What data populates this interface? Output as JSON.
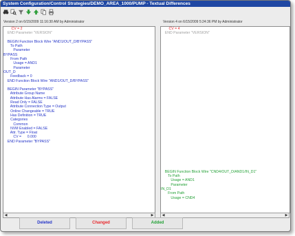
{
  "window": {
    "title": "System Configuration/Control Strategies/DEMO_AREA_1000/PUMP - Textual Differences"
  },
  "toolbar": {
    "icons": [
      "binoculars-icon",
      "find-next-icon",
      "filter-icon",
      "next-difference-icon",
      "previous-difference-icon",
      "copy-icon",
      "print-icon"
    ]
  },
  "left": {
    "header": "Version 2 on 6/15/2009 11:16:30 AM by Administrator",
    "lines": [
      {
        "t": "        CV = 2",
        "k": "c"
      },
      {
        "t": "    END Parameter \"VERSION\"",
        "k": "u"
      },
      {
        "t": "",
        "k": "u"
      },
      {
        "t": "    BEGIN Function Block Wire \"AND1/OUT_D/BYPASS\"",
        "k": "d"
      },
      {
        "t": "       To Path",
        "k": "d"
      },
      {
        "t": "          Parameter",
        "k": "d"
      },
      {
        "t": "BYPASS",
        "k": "d"
      },
      {
        "t": "       From Path",
        "k": "d"
      },
      {
        "t": "          Usage = AND1",
        "k": "d"
      },
      {
        "t": "          Parameter",
        "k": "d"
      },
      {
        "t": "OUT_D",
        "k": "d"
      },
      {
        "t": "       Feedback = 0",
        "k": "d"
      },
      {
        "t": "    END Function Block Wire \"AND1/OUT_D/BYPASS\"",
        "k": "d"
      },
      {
        "t": "",
        "k": "d"
      },
      {
        "t": "    BEGIN Parameter \"BYPASS\"",
        "k": "d"
      },
      {
        "t": "       Attribute Group Name",
        "k": "d"
      },
      {
        "t": "       Attribute Has Alarms = FALSE",
        "k": "d"
      },
      {
        "t": "       Read Only = FALSE",
        "k": "d"
      },
      {
        "t": "       Attribute Connection Type = Output",
        "k": "d"
      },
      {
        "t": "       Online Changeable = TRUE",
        "k": "d"
      },
      {
        "t": "       Has Definition = TRUE",
        "k": "d"
      },
      {
        "t": "       Categories",
        "k": "d"
      },
      {
        "t": "          Common",
        "k": "d"
      },
      {
        "t": "       NVM Enabled = FALSE",
        "k": "d"
      },
      {
        "t": "       Attr. Type = Float",
        "k": "d"
      },
      {
        "t": "          CV =      0.000",
        "k": "d"
      },
      {
        "t": "    END Parameter \"BYPASS\"",
        "k": "d"
      }
    ]
  },
  "right": {
    "header": "Version 4 on 6/15/2009 5:24:36 PM by Administrator",
    "lines": [
      {
        "t": "        CV = 4",
        "k": "c"
      },
      {
        "t": "    END Parameter \"VERSION\"",
        "k": "u"
      },
      {
        "t": "",
        "k": "u"
      },
      {
        "t": "",
        "k": "u"
      },
      {
        "t": "",
        "k": "u"
      },
      {
        "t": "",
        "k": "u"
      },
      {
        "t": "",
        "k": "u"
      },
      {
        "t": "",
        "k": "u"
      },
      {
        "t": "",
        "k": "u"
      },
      {
        "t": "",
        "k": "u"
      },
      {
        "t": "",
        "k": "u"
      },
      {
        "t": "",
        "k": "u"
      },
      {
        "t": "",
        "k": "u"
      },
      {
        "t": "",
        "k": "u"
      },
      {
        "t": "",
        "k": "u"
      },
      {
        "t": "",
        "k": "u"
      },
      {
        "t": "",
        "k": "u"
      },
      {
        "t": "",
        "k": "u"
      },
      {
        "t": "",
        "k": "u"
      },
      {
        "t": "",
        "k": "u"
      },
      {
        "t": "",
        "k": "u"
      },
      {
        "t": "",
        "k": "u"
      },
      {
        "t": "",
        "k": "u"
      },
      {
        "t": "",
        "k": "u"
      },
      {
        "t": "",
        "k": "u"
      },
      {
        "t": "",
        "k": "u"
      },
      {
        "t": "",
        "k": "u"
      },
      {
        "t": "",
        "k": "u"
      },
      {
        "t": "",
        "k": "u"
      },
      {
        "t": "",
        "k": "u"
      },
      {
        "t": "",
        "k": "u"
      },
      {
        "t": "",
        "k": "u"
      },
      {
        "t": "",
        "k": "u"
      },
      {
        "t": "    BEGIN Function Block Wire \"CND4/OUT_D/AND1/IN_D1\"",
        "k": "a"
      },
      {
        "t": "       To Path",
        "k": "a"
      },
      {
        "t": "          Usage = AND1",
        "k": "a"
      },
      {
        "t": "          Parameter",
        "k": "a"
      },
      {
        "t": "IN_D1",
        "k": "a"
      },
      {
        "t": "       From Path",
        "k": "a"
      },
      {
        "t": "          Usage = CND4",
        "k": "a"
      }
    ]
  },
  "legend": {
    "deleted": "Deleted",
    "changed": "Changed",
    "added": "Added"
  },
  "colors": {
    "title_bg": "#1f47a3",
    "deleted": "#2535c8",
    "changed": "#e8282c",
    "added": "#22a035",
    "unchanged": "#a0a0a0"
  }
}
